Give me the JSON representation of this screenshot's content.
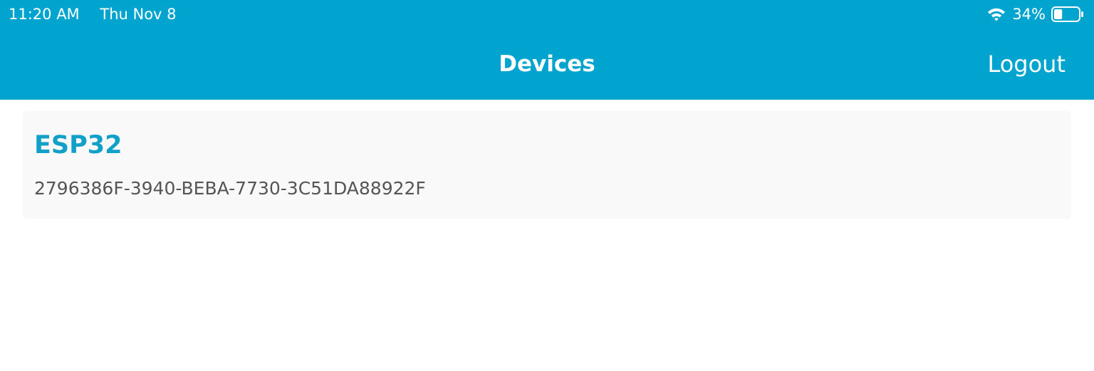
{
  "status_bar": {
    "time": "11:20 AM",
    "date": "Thu Nov 8",
    "battery_percent": "34%",
    "battery_level": 0.34,
    "wifi_icon": "wifi-icon",
    "battery_icon": "battery-icon"
  },
  "nav": {
    "title": "Devices",
    "logout_label": "Logout"
  },
  "devices": [
    {
      "name": "ESP32",
      "id": "2796386F-3940-BEBA-7730-3C51DA88922F"
    }
  ],
  "colors": {
    "header_bg": "#00a4cf",
    "accent_text": "#11a1c8",
    "card_bg": "#f9f9f9",
    "secondary_text": "#555555"
  }
}
